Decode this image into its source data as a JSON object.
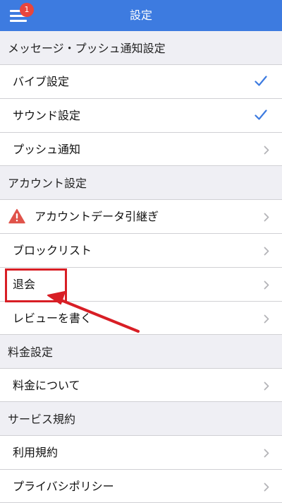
{
  "header": {
    "title": "設定",
    "badge_count": "1"
  },
  "sections": [
    {
      "title": "メッセージ・プッシュ通知設定",
      "items": [
        {
          "label": "バイブ設定",
          "trailing": "check"
        },
        {
          "label": "サウンド設定",
          "trailing": "check"
        },
        {
          "label": "プッシュ通知",
          "trailing": "chevron"
        }
      ]
    },
    {
      "title": "アカウント設定",
      "items": [
        {
          "label": "アカウントデータ引継ぎ",
          "trailing": "chevron",
          "leading_icon": "warning-icon"
        },
        {
          "label": "ブロックリスト",
          "trailing": "chevron"
        },
        {
          "label": "退会",
          "trailing": "chevron",
          "highlighted": true
        },
        {
          "label": "レビューを書く",
          "trailing": "chevron"
        }
      ]
    },
    {
      "title": "料金設定",
      "items": [
        {
          "label": "料金について",
          "trailing": "chevron"
        }
      ]
    },
    {
      "title": "サービス規約",
      "items": [
        {
          "label": "利用規約",
          "trailing": "chevron"
        },
        {
          "label": "プライバシポリシー",
          "trailing": "chevron"
        }
      ]
    }
  ],
  "colors": {
    "header_bg": "#3d7be0",
    "badge": "#e8453c",
    "check": "#3d7be0",
    "chevron": "#b4b4b8",
    "annotation": "#d81e25",
    "warning": "#e0534a"
  }
}
